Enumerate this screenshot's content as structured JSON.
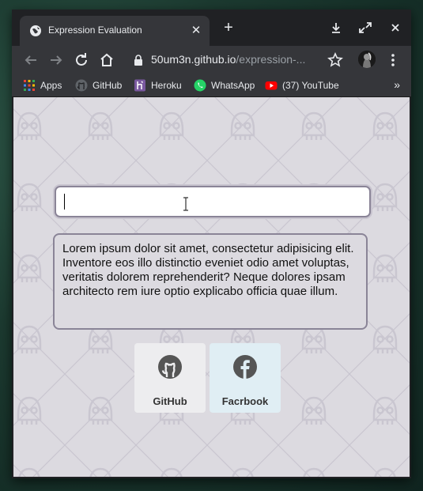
{
  "browser": {
    "tab_title": "Expression Evaluation",
    "url_host": "50um3n.github.io",
    "url_path": "/expression-..."
  },
  "bookmarks": [
    "Apps",
    "GitHub",
    "Heroku",
    "WhatsApp",
    "(37) YouTube"
  ],
  "page": {
    "input_value": "",
    "paragraph": "Lorem ipsum dolor sit amet, consectetur adipisicing elit. Inventore eos illo distinctio eveniet odio amet voluptas, veritatis dolorem reprehenderit? Neque dolores ipsam architecto rem iure optio explicabo officia quae illum.",
    "links": [
      {
        "label": "GitHub",
        "icon": "github-icon"
      },
      {
        "label": "Facrbook",
        "icon": "facebook-icon"
      }
    ]
  },
  "colors": {
    "page_background": "#dcdae0",
    "pattern": "#c9c6d0",
    "facebook_card": "#e0eef4",
    "github_card": "#ededef"
  }
}
